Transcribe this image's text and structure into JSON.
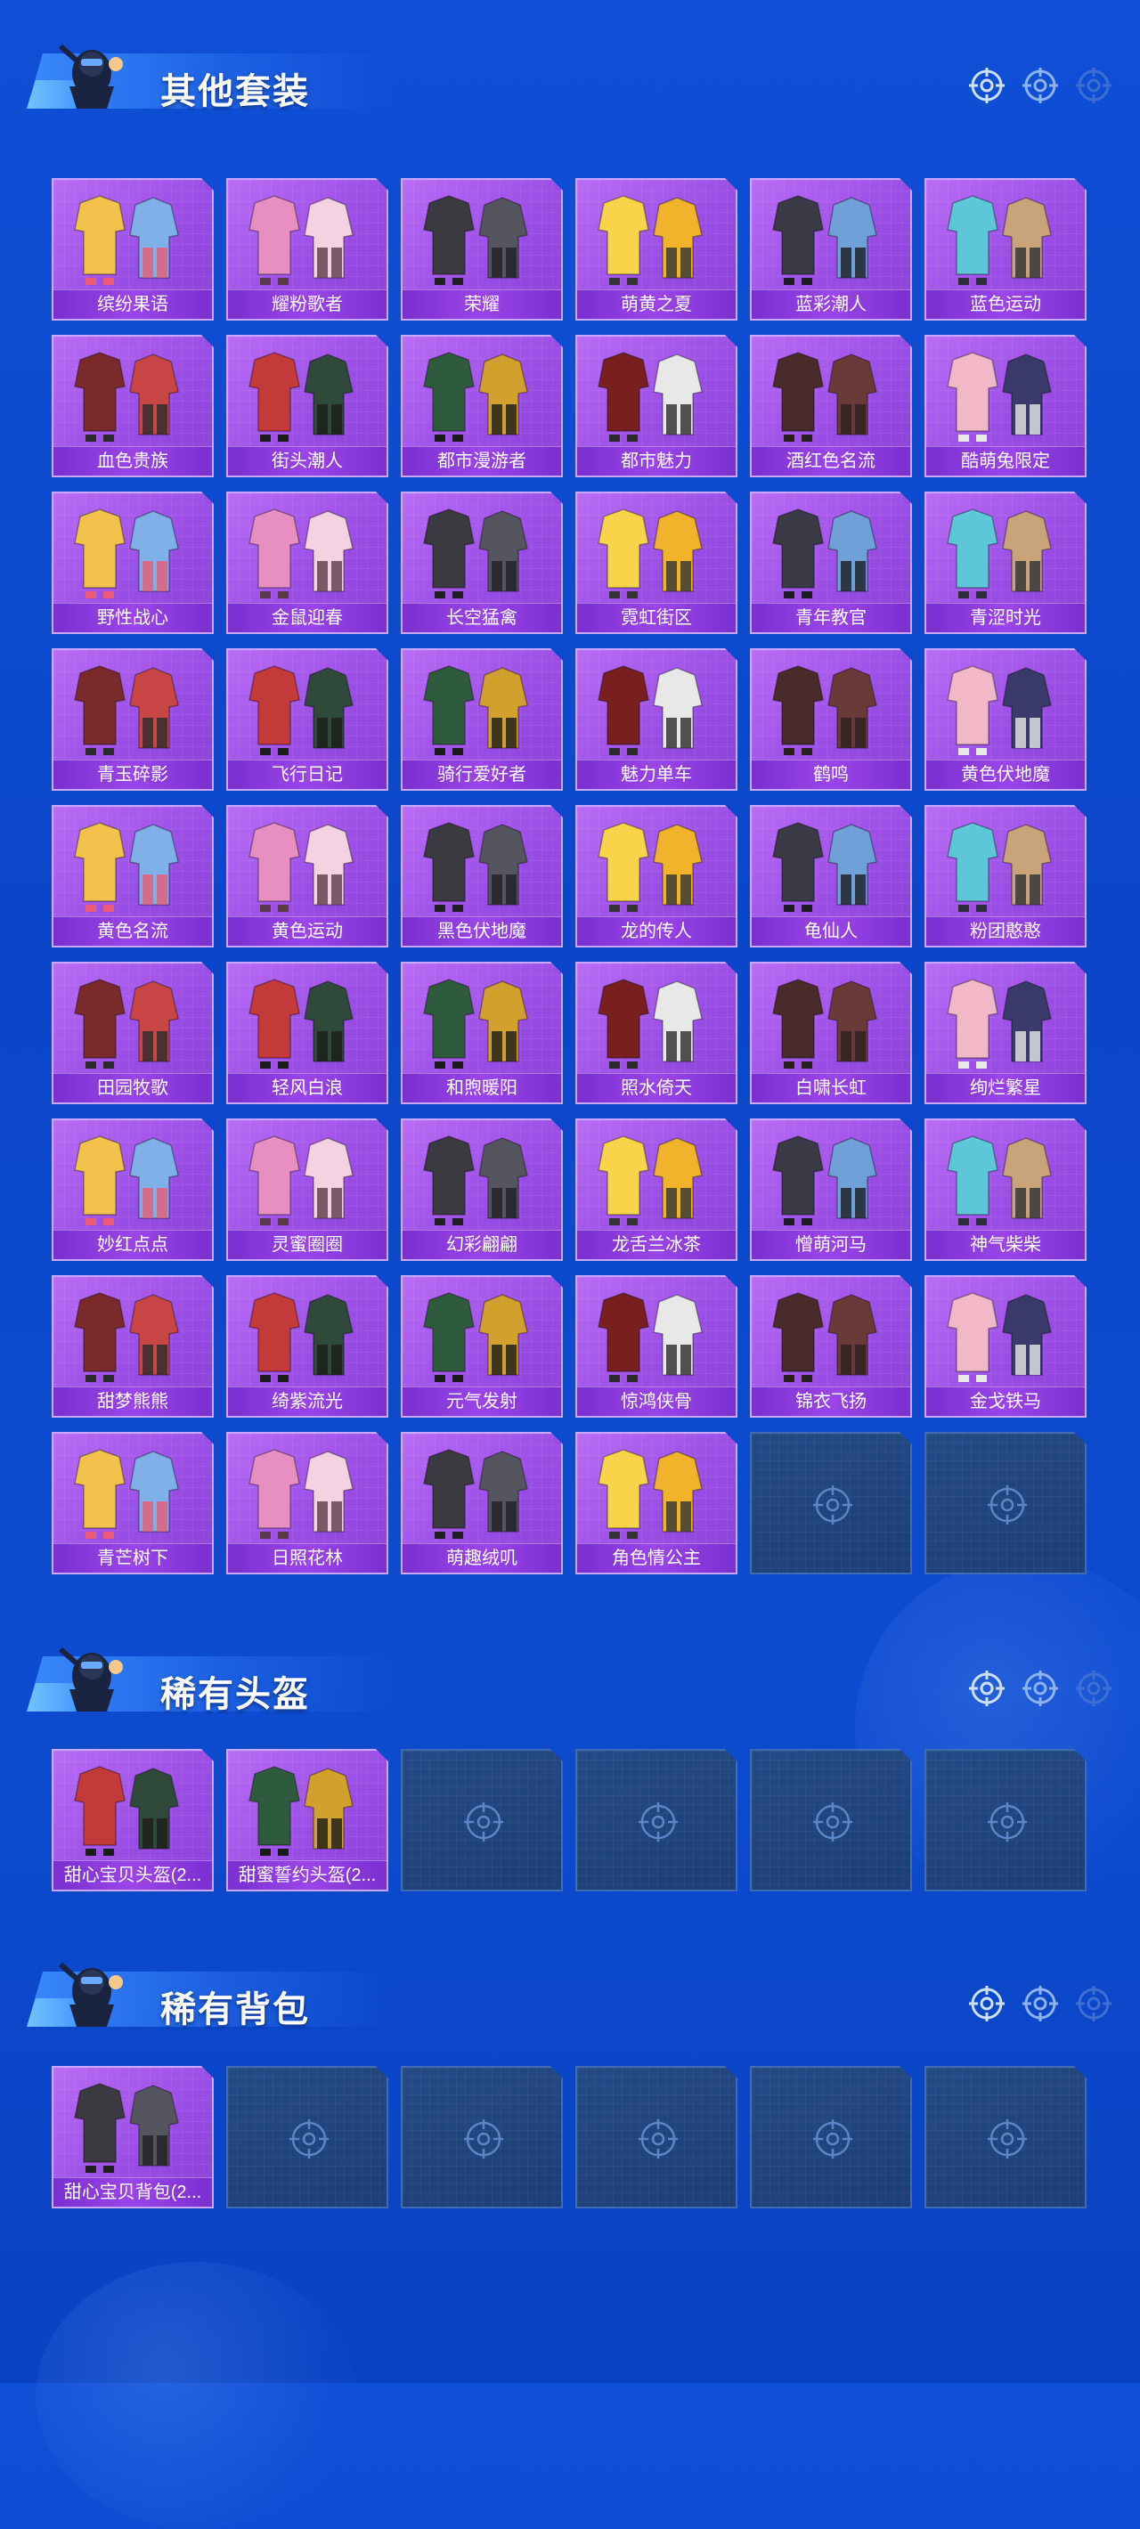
{
  "colors": {
    "background": "#0b46c8",
    "card": "#9b4ee6",
    "card_label": "#7a2fd0",
    "empty_card": "#1d3e76"
  },
  "sections": [
    {
      "title": "其他套装",
      "items": [
        "缤纷果语",
        "耀粉歌者",
        "荣耀",
        "萌黄之夏",
        "蓝彩潮人",
        "蓝色运动",
        "血色贵族",
        "街头潮人",
        "都市漫游者",
        "都市魅力",
        "酒红色名流",
        "酷萌兔限定",
        "野性战心",
        "金鼠迎春",
        "长空猛禽",
        "霓虹街区",
        "青年教官",
        "青涩时光",
        "青玉碎影",
        "飞行日记",
        "骑行爱好者",
        "魅力单车",
        "鹤鸣",
        "黄色伏地魔",
        "黄色名流",
        "黄色运动",
        "黑色伏地魔",
        "龙的传人",
        "龟仙人",
        "粉团憨憨",
        "田园牧歌",
        "轻风白浪",
        "和煦暖阳",
        "照水倚天",
        "白啸长虹",
        "绚烂繁星",
        "妙红点点",
        "灵蜜圈圈",
        "幻彩翩翩",
        "龙舌兰冰茶",
        "憎萌河马",
        "神气柴柴",
        "甜梦熊熊",
        "绮紫流光",
        "元气发射",
        "惊鸿侠骨",
        "锦衣飞扬",
        "金戈铁马",
        "青芒树下",
        "日照花林",
        "萌趣绒叽",
        "角色情公主"
      ],
      "empty_slots": 2
    },
    {
      "title": "稀有头盔",
      "items": [
        "甜心宝贝头盔(2...",
        "甜蜜誓约头盔(2..."
      ],
      "empty_slots": 4
    },
    {
      "title": "稀有背包",
      "items": [
        "甜心宝贝背包(2..."
      ],
      "empty_slots": 5
    }
  ]
}
